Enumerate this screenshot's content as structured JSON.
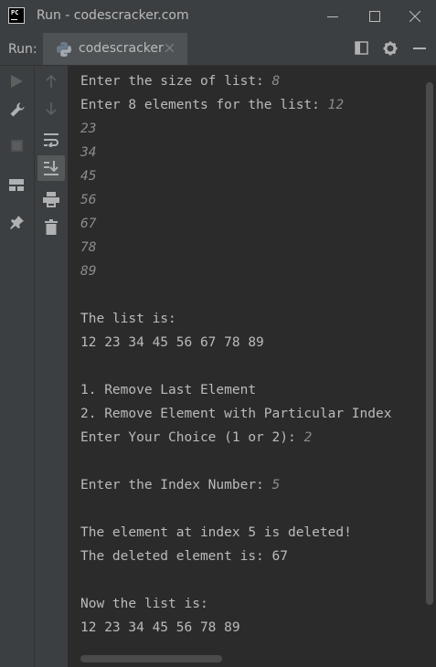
{
  "window": {
    "title": "Run - codescracker.com",
    "app_icon_text": "PC"
  },
  "run_panel": {
    "label": "Run:",
    "tab_label": "codescracker"
  },
  "console": [
    {
      "text": "Enter the size of list: ",
      "input": "8"
    },
    {
      "text": "Enter 8 elements for the list: ",
      "input": "12"
    },
    {
      "text": "",
      "input": "23"
    },
    {
      "text": "",
      "input": "34"
    },
    {
      "text": "",
      "input": "45"
    },
    {
      "text": "",
      "input": "56"
    },
    {
      "text": "",
      "input": "67"
    },
    {
      "text": "",
      "input": "78"
    },
    {
      "text": "",
      "input": "89"
    },
    {
      "text": "",
      "input": ""
    },
    {
      "text": "The list is:",
      "input": ""
    },
    {
      "text": "12 23 34 45 56 67 78 89",
      "input": ""
    },
    {
      "text": "",
      "input": ""
    },
    {
      "text": "1. Remove Last Element",
      "input": ""
    },
    {
      "text": "2. Remove Element with Particular Index",
      "input": ""
    },
    {
      "text": "Enter Your Choice (1 or 2): ",
      "input": "2"
    },
    {
      "text": "",
      "input": ""
    },
    {
      "text": "Enter the Index Number: ",
      "input": "5"
    },
    {
      "text": "",
      "input": ""
    },
    {
      "text": "The element at index 5 is deleted!",
      "input": ""
    },
    {
      "text": "The deleted element is: 67",
      "input": ""
    },
    {
      "text": "",
      "input": ""
    },
    {
      "text": "Now the list is:",
      "input": ""
    },
    {
      "text": "12 23 34 45 56 78 89",
      "input": ""
    }
  ],
  "colors": {
    "output_text": "#bbbbbb",
    "user_input": "#8c8c8c",
    "background": "#2b2b2b",
    "chrome": "#3c3f41"
  },
  "icons": {
    "titlebar": [
      "minimize-icon",
      "maximize-icon",
      "close-icon"
    ],
    "run_bar_right": [
      "layout-icon",
      "gear-icon",
      "hide-icon"
    ],
    "left_toolbar": [
      "rerun-icon",
      "wrench-icon",
      "stop-icon",
      "layout-icon",
      "pin-icon"
    ],
    "right_toolbar": [
      "scroll-up-icon",
      "scroll-down-icon",
      "soft-wrap-icon",
      "scroll-to-end-icon",
      "print-icon",
      "trash-icon"
    ]
  }
}
